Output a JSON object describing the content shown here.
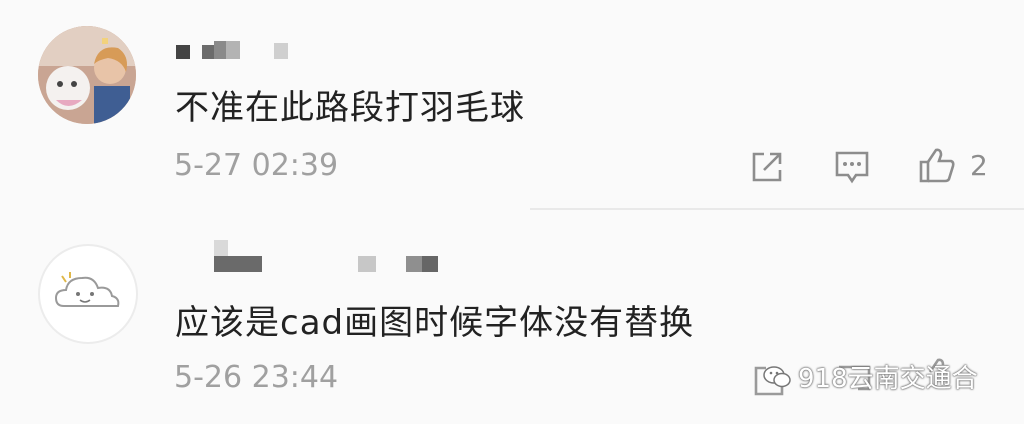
{
  "comments": [
    {
      "text": "不准在此路段打羽毛球",
      "time": "5-27 02:39",
      "likes": "2"
    },
    {
      "text": "应该是cad画图时候字体没有替换",
      "time": "5-26 23:44",
      "likes": ""
    }
  ],
  "watermark": {
    "text": "918云南交通合"
  },
  "icons": [
    "share-icon",
    "comment-icon",
    "like-icon"
  ],
  "colors": {
    "background": "#fafafa",
    "text": "#222222",
    "meta": "#a0a0a0"
  }
}
